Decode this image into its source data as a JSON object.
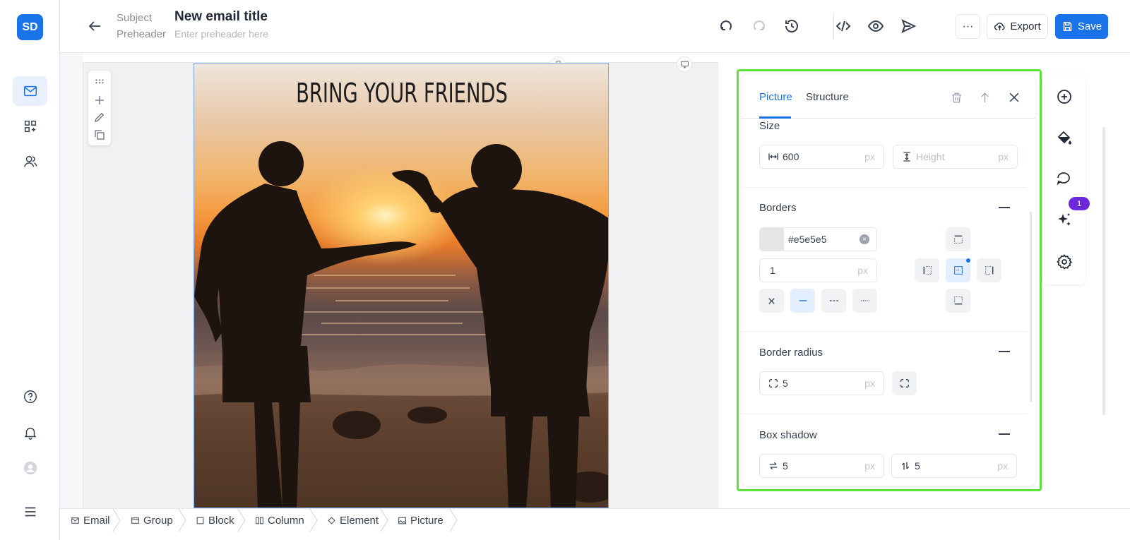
{
  "app": {
    "logo_text": "SD",
    "accent_color": "#1a73e8",
    "highlight_color": "#5ce23a"
  },
  "header": {
    "subject_label": "Subject",
    "preheader_label": "Preheader",
    "title": "New email title",
    "preheader_placeholder": "Enter preheader here",
    "more_label": "···",
    "export_label": "Export",
    "save_label": "Save"
  },
  "canvas": {
    "image_text": "BRING YOUR FRIENDS"
  },
  "panel": {
    "tabs": [
      "Picture",
      "Structure"
    ],
    "active_tab": "Picture",
    "size": {
      "title": "Size",
      "width_value": "600",
      "width_unit": "px",
      "height_placeholder": "Height",
      "height_unit": "px"
    },
    "borders": {
      "title": "Borders",
      "color_value": "#e5e5e5",
      "width_value": "1",
      "width_unit": "px"
    },
    "border_radius": {
      "title": "Border radius",
      "value": "5",
      "unit": "px"
    },
    "box_shadow": {
      "title": "Box shadow",
      "x_value": "5",
      "y_value": "5",
      "unit": "px"
    }
  },
  "rail": {
    "badge_count": "1"
  },
  "breadcrumb": [
    "Email",
    "Group",
    "Block",
    "Column",
    "Element",
    "Picture"
  ]
}
